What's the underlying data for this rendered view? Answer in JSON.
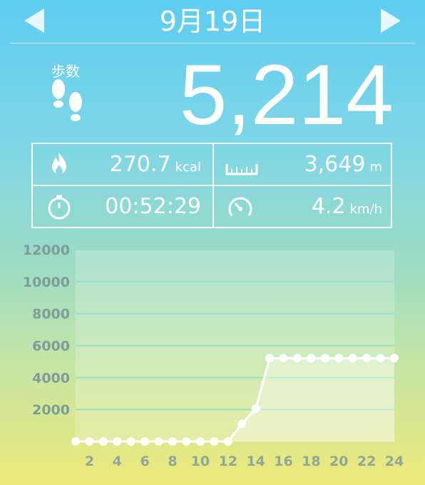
{
  "header": {
    "date": "9月19日"
  },
  "steps": {
    "label": "歩数",
    "value": "5,214"
  },
  "stats": {
    "calories": {
      "value": "270.7",
      "unit": "kcal",
      "icon": "flame-icon"
    },
    "distance": {
      "value": "3,649",
      "unit": "m",
      "icon": "ruler-icon"
    },
    "time": {
      "value": "00:52:29",
      "icon": "stopwatch-icon"
    },
    "speed": {
      "value": "4.2",
      "unit": "km/h",
      "icon": "speedometer-icon"
    }
  },
  "chart_data": {
    "type": "line",
    "x": [
      1,
      2,
      3,
      4,
      5,
      6,
      7,
      8,
      9,
      10,
      11,
      12,
      13,
      14,
      15,
      16,
      17,
      18,
      19,
      20,
      21,
      22,
      23,
      24
    ],
    "values": [
      0,
      0,
      0,
      0,
      0,
      0,
      0,
      0,
      0,
      0,
      0,
      0,
      1100,
      2050,
      5214,
      5214,
      5214,
      5214,
      5214,
      5214,
      5214,
      5214,
      5214,
      5214
    ],
    "xticks": [
      "2",
      "4",
      "6",
      "8",
      "10",
      "12",
      "14",
      "16",
      "18",
      "20",
      "22",
      "24"
    ],
    "yticks": [
      "2000",
      "4000",
      "6000",
      "8000",
      "10000",
      "12000"
    ],
    "ylim": [
      0,
      12000
    ],
    "xlim": [
      1,
      24
    ],
    "grid": true
  }
}
